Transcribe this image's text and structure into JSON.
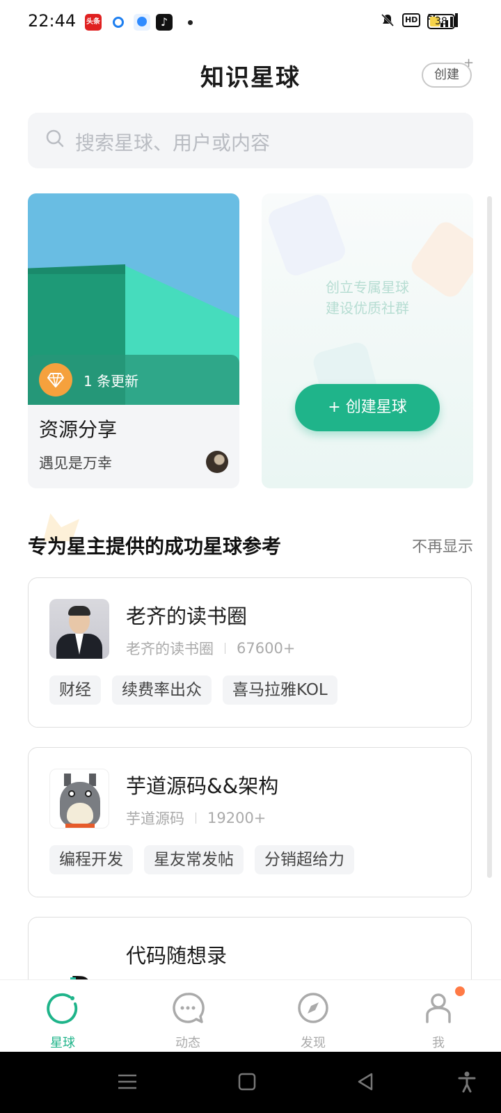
{
  "status_bar": {
    "time": "22:44",
    "toutiao_icon_text": "头条",
    "network": "5G",
    "hd": "HD",
    "battery": "38",
    "icons": [
      "toutiao-icon",
      "circle-app-icon",
      "qq-browser-icon",
      "tiktok-icon",
      "notification-dot",
      "mute-bell-icon",
      "hd-icon",
      "signal-5g-icon",
      "battery-icon"
    ]
  },
  "header": {
    "title": "知识星球",
    "create_label": "创建",
    "create_plus": "+"
  },
  "search": {
    "placeholder": "搜索星球、用户或内容"
  },
  "my_circle": {
    "update_text": "1 条更新",
    "name": "资源分享",
    "owner": "遇见是万幸"
  },
  "create_card": {
    "tip_line1": "创立专属星球",
    "tip_line2": "建设优质社群",
    "button_label": "+ 创建星球"
  },
  "section": {
    "title": "专为星主提供的成功星球参考",
    "hide_label": "不再显示"
  },
  "recommendations": [
    {
      "name": "老齐的读书圈",
      "owner": "老齐的读书圈",
      "members": "67600+",
      "tags": [
        "财经",
        "续费率出众",
        "喜马拉雅KOL"
      ]
    },
    {
      "name": "芋道源码&&架构",
      "owner": "芋道源码",
      "members": "19200+",
      "tags": [
        "编程开发",
        "星友常发帖",
        "分销超给力"
      ]
    },
    {
      "name": "代码随想录"
    }
  ],
  "tabs": [
    {
      "label": "星球",
      "icon": "planet-icon"
    },
    {
      "label": "动态",
      "icon": "chat-bubble-icon"
    },
    {
      "label": "发现",
      "icon": "compass-icon"
    },
    {
      "label": "我",
      "icon": "person-icon"
    }
  ],
  "colors": {
    "accent": "#1fb48a",
    "badge": "#f5a13d",
    "notify": "#ff7a45"
  }
}
